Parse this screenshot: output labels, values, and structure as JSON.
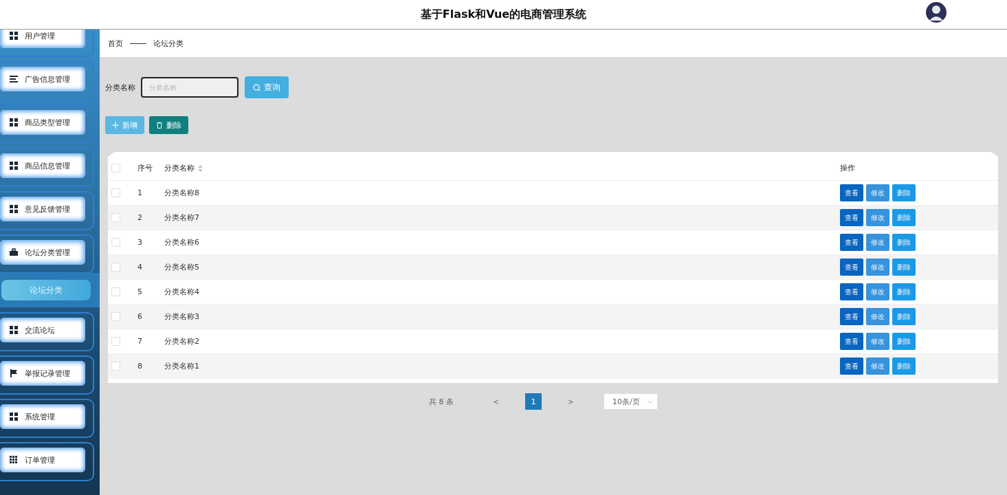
{
  "header": {
    "title": "基于Flask和Vue的电商管理系统"
  },
  "sidebar": {
    "items": [
      {
        "label": "用户管理",
        "expanded": false
      },
      {
        "label": "广告信息管理",
        "expanded": false
      },
      {
        "label": "商品类型管理",
        "expanded": false
      },
      {
        "label": "商品信息管理",
        "expanded": false
      },
      {
        "label": "意见反馈管理",
        "expanded": false
      },
      {
        "label": "论坛分类管理",
        "expanded": true,
        "children": [
          {
            "label": "论坛分类",
            "selected": true
          }
        ]
      },
      {
        "label": "交流论坛",
        "expanded": false
      },
      {
        "label": "举报记录管理",
        "expanded": false
      },
      {
        "label": "系统管理",
        "expanded": false
      },
      {
        "label": "订单管理",
        "expanded": false
      }
    ]
  },
  "breadcrumb": [
    "首页",
    "论坛分类"
  ],
  "search": {
    "label": "分类名称",
    "placeholder": "分类名称",
    "button": "查询"
  },
  "actions": [
    {
      "label": "新增",
      "kind": "add"
    },
    {
      "label": "删除",
      "kind": "delete"
    }
  ],
  "table": {
    "select_all": {
      "checked": false
    },
    "columns": [
      {
        "label": "序号",
        "sortable": false
      },
      {
        "label": "分类名称",
        "sortable": true
      },
      {
        "label": "操作",
        "sortable": false
      }
    ],
    "rows": [
      {
        "index": "1",
        "name": "分类名称8",
        "checked": false,
        "buttons": [
          "查看",
          "修改",
          "删除"
        ]
      },
      {
        "index": "2",
        "name": "分类名称7",
        "checked": false,
        "buttons": [
          "查看",
          "修改",
          "删除"
        ]
      },
      {
        "index": "3",
        "name": "分类名称6",
        "checked": false,
        "buttons": [
          "查看",
          "修改",
          "删除"
        ]
      },
      {
        "index": "4",
        "name": "分类名称5",
        "checked": false,
        "buttons": [
          "查看",
          "修改",
          "删除"
        ]
      },
      {
        "index": "5",
        "name": "分类名称4",
        "checked": false,
        "buttons": [
          "查看",
          "修改",
          "删除"
        ]
      },
      {
        "index": "6",
        "name": "分类名称3",
        "checked": false,
        "buttons": [
          "查看",
          "修改",
          "删除"
        ]
      },
      {
        "index": "7",
        "name": "分类名称2",
        "checked": false,
        "buttons": [
          "查看",
          "修改",
          "删除"
        ]
      },
      {
        "index": "8",
        "name": "分类名称1",
        "checked": false,
        "buttons": [
          "查看",
          "修改",
          "删除"
        ]
      }
    ]
  },
  "pagination": {
    "total": "共 8 条",
    "prev": "<",
    "pages": [
      {
        "label": "1",
        "selected": true
      }
    ],
    "next": ">",
    "page_size": "10条/页"
  }
}
